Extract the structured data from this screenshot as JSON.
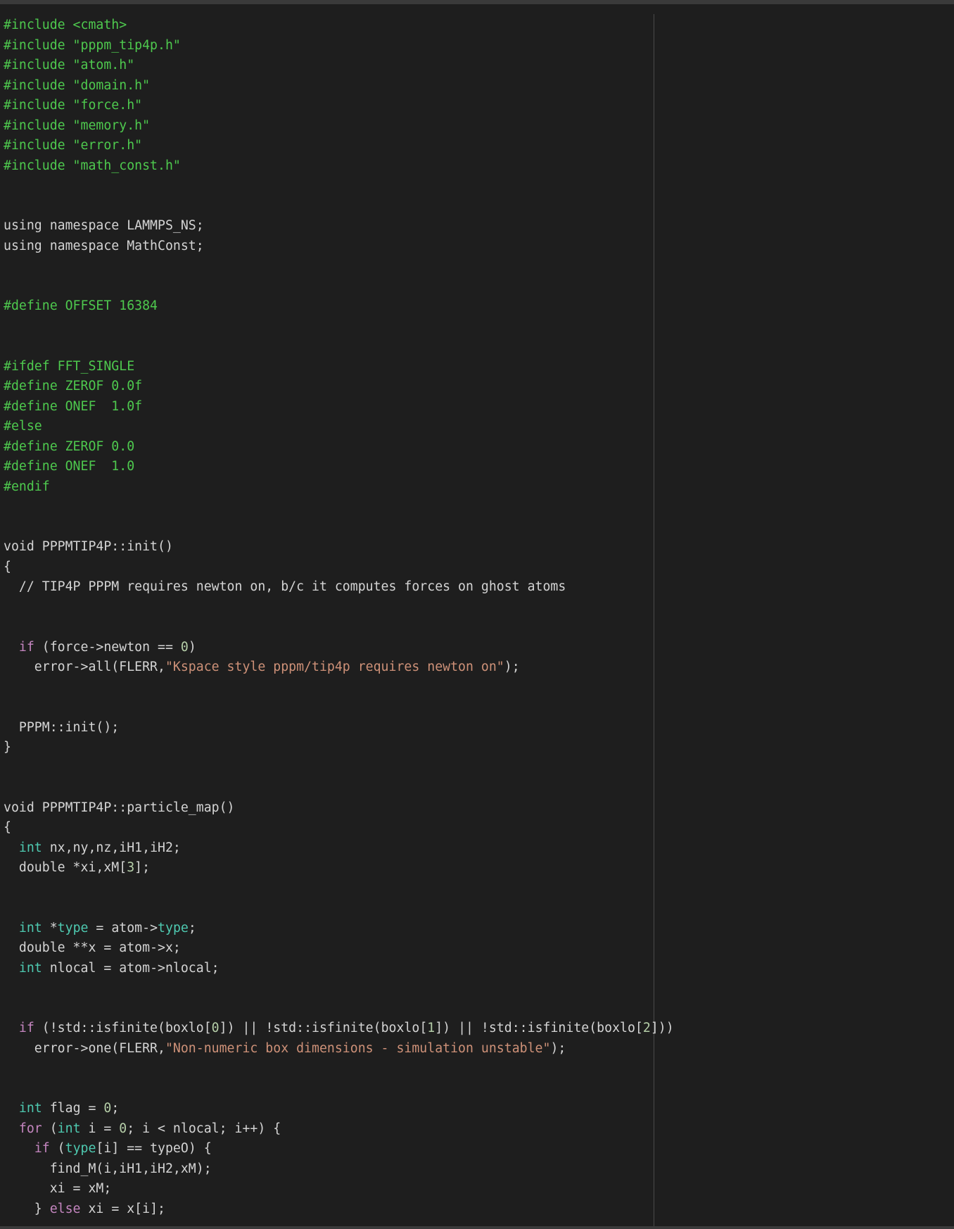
{
  "lines": [
    [
      {
        "t": "#include <cmath>",
        "c": "prep"
      }
    ],
    [
      {
        "t": "#include \"pppm_tip4p.h\"",
        "c": "prep"
      }
    ],
    [
      {
        "t": "#include \"atom.h\"",
        "c": "prep"
      }
    ],
    [
      {
        "t": "#include \"domain.h\"",
        "c": "prep"
      }
    ],
    [
      {
        "t": "#include \"force.h\"",
        "c": "prep"
      }
    ],
    [
      {
        "t": "#include \"memory.h\"",
        "c": "prep"
      }
    ],
    [
      {
        "t": "#include \"error.h\"",
        "c": "prep"
      }
    ],
    [
      {
        "t": "#include \"math_const.h\"",
        "c": "prep"
      }
    ],
    [],
    [],
    [
      {
        "t": "using namespace LAMMPS_NS;",
        "c": "plain"
      }
    ],
    [
      {
        "t": "using namespace MathConst;",
        "c": "plain"
      }
    ],
    [],
    [],
    [
      {
        "t": "#define OFFSET 16384",
        "c": "prep"
      }
    ],
    [],
    [],
    [
      {
        "t": "#ifdef FFT_SINGLE",
        "c": "prep"
      }
    ],
    [
      {
        "t": "#define ZEROF 0.0f",
        "c": "prep"
      }
    ],
    [
      {
        "t": "#define ONEF  1.0f",
        "c": "prep"
      }
    ],
    [
      {
        "t": "#else",
        "c": "prep"
      }
    ],
    [
      {
        "t": "#define ZEROF 0.0",
        "c": "prep"
      }
    ],
    [
      {
        "t": "#define ONEF  1.0",
        "c": "prep"
      }
    ],
    [
      {
        "t": "#endif",
        "c": "prep"
      }
    ],
    [],
    [],
    [
      {
        "t": "void PPPMTIP4P::init()",
        "c": "plain"
      }
    ],
    [
      {
        "t": "{",
        "c": "plain"
      }
    ],
    [
      {
        "t": "  // TIP4P PPPM requires newton on, b/c it computes forces on ghost atoms",
        "c": "cm"
      }
    ],
    [],
    [],
    [
      {
        "t": "  ",
        "c": "plain"
      },
      {
        "t": "if",
        "c": "kw-purple"
      },
      {
        "t": " (force->newton == ",
        "c": "plain"
      },
      {
        "t": "0",
        "c": "num"
      },
      {
        "t": ")",
        "c": "plain"
      }
    ],
    [
      {
        "t": "    error->all(FLERR,",
        "c": "plain"
      },
      {
        "t": "\"Kspace style pppm/tip4p requires newton on\"",
        "c": "str"
      },
      {
        "t": ");",
        "c": "plain"
      }
    ],
    [],
    [],
    [
      {
        "t": "  PPPM::init();",
        "c": "plain"
      }
    ],
    [
      {
        "t": "}",
        "c": "plain"
      }
    ],
    [],
    [],
    [
      {
        "t": "void PPPMTIP4P::particle_map()",
        "c": "plain"
      }
    ],
    [
      {
        "t": "{",
        "c": "plain"
      }
    ],
    [
      {
        "t": "  ",
        "c": "plain"
      },
      {
        "t": "int",
        "c": "kw-blue"
      },
      {
        "t": " nx,ny,nz,iH1,iH2;",
        "c": "plain"
      }
    ],
    [
      {
        "t": "  double *xi,xM[",
        "c": "plain"
      },
      {
        "t": "3",
        "c": "num"
      },
      {
        "t": "];",
        "c": "plain"
      }
    ],
    [],
    [],
    [
      {
        "t": "  ",
        "c": "plain"
      },
      {
        "t": "int",
        "c": "kw-blue"
      },
      {
        "t": " *",
        "c": "plain"
      },
      {
        "t": "type",
        "c": "kw-blue"
      },
      {
        "t": " = atom->",
        "c": "plain"
      },
      {
        "t": "type",
        "c": "kw-blue"
      },
      {
        "t": ";",
        "c": "plain"
      }
    ],
    [
      {
        "t": "  double **x = atom->x;",
        "c": "plain"
      }
    ],
    [
      {
        "t": "  ",
        "c": "plain"
      },
      {
        "t": "int",
        "c": "kw-blue"
      },
      {
        "t": " nlocal = atom->nlocal;",
        "c": "plain"
      }
    ],
    [],
    [],
    [
      {
        "t": "  ",
        "c": "plain"
      },
      {
        "t": "if",
        "c": "kw-purple"
      },
      {
        "t": " (!std::isfinite(boxlo[",
        "c": "plain"
      },
      {
        "t": "0",
        "c": "num"
      },
      {
        "t": "]) || !std::isfinite(boxlo[",
        "c": "plain"
      },
      {
        "t": "1",
        "c": "num"
      },
      {
        "t": "]) || !std::isfinite(boxlo[",
        "c": "plain"
      },
      {
        "t": "2",
        "c": "num"
      },
      {
        "t": "]))",
        "c": "plain"
      }
    ],
    [
      {
        "t": "    error->one(FLERR,",
        "c": "plain"
      },
      {
        "t": "\"Non-numeric box dimensions - simulation unstable\"",
        "c": "str"
      },
      {
        "t": ");",
        "c": "plain"
      }
    ],
    [],
    [],
    [
      {
        "t": "  ",
        "c": "plain"
      },
      {
        "t": "int",
        "c": "kw-blue"
      },
      {
        "t": " flag = ",
        "c": "plain"
      },
      {
        "t": "0",
        "c": "num"
      },
      {
        "t": ";",
        "c": "plain"
      }
    ],
    [
      {
        "t": "  ",
        "c": "plain"
      },
      {
        "t": "for",
        "c": "kw-purple"
      },
      {
        "t": " (",
        "c": "plain"
      },
      {
        "t": "int",
        "c": "kw-blue"
      },
      {
        "t": " i = ",
        "c": "plain"
      },
      {
        "t": "0",
        "c": "num"
      },
      {
        "t": "; i < nlocal; i++) {",
        "c": "plain"
      }
    ],
    [
      {
        "t": "    ",
        "c": "plain"
      },
      {
        "t": "if",
        "c": "kw-purple"
      },
      {
        "t": " (",
        "c": "plain"
      },
      {
        "t": "type",
        "c": "kw-blue"
      },
      {
        "t": "[i] == typeO) {",
        "c": "plain"
      }
    ],
    [
      {
        "t": "      find_M(i,iH1,iH2,xM);",
        "c": "plain"
      }
    ],
    [
      {
        "t": "      xi = xM;",
        "c": "plain"
      }
    ],
    [
      {
        "t": "    } ",
        "c": "plain"
      },
      {
        "t": "else",
        "c": "kw-purple"
      },
      {
        "t": " xi = x[i];",
        "c": "plain"
      }
    ]
  ],
  "colors": {
    "background": "#1e1e1e",
    "preprocessor": "#4ec94e",
    "type_keyword": "#4ec9b0",
    "control_keyword": "#c586c0",
    "string": "#ce9178",
    "number": "#b5cea8",
    "text": "#d4d4d4"
  }
}
